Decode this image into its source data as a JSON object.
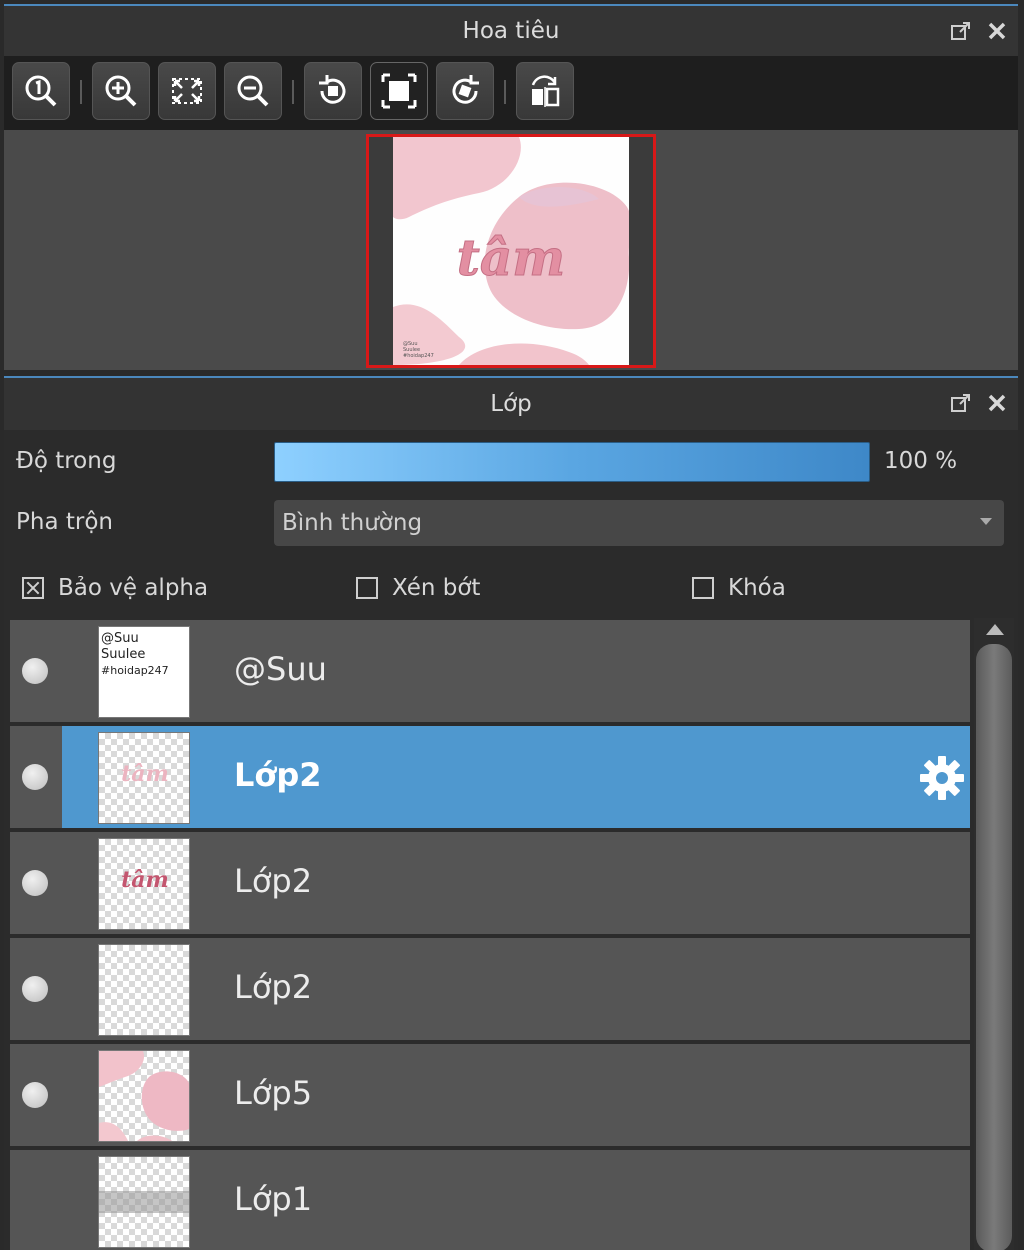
{
  "navigator": {
    "title": "Hoa tiêu",
    "toolbar": [
      "zoom-actual-size-icon",
      "zoom-in-icon",
      "fit-screen-icon",
      "zoom-out-icon",
      "rotate-left-icon",
      "fit-canvas-icon",
      "rotate-right-icon",
      "flip-horizontal-icon"
    ],
    "preview": {
      "artwork_text": "tâm",
      "watermark_lines": [
        "@Suu",
        "Suulee",
        "#hoidap247"
      ]
    }
  },
  "layers_panel": {
    "title": "Lớp",
    "opacity_label": "Độ trong",
    "opacity_value_text": "100 %",
    "opacity_value": 100,
    "blend_label": "Pha trộn",
    "blend_value": "Bình thường",
    "checkboxes": [
      {
        "label": "Bảo vệ alpha",
        "checked": true
      },
      {
        "label": "Xén bớt",
        "checked": false
      },
      {
        "label": "Khóa",
        "checked": false
      }
    ],
    "layers": [
      {
        "name": "@Suu",
        "thumb_text": [
          "@Suu",
          "Suulee",
          "#hoidap247"
        ],
        "visible": true,
        "selected": false
      },
      {
        "name": "Lớp2",
        "thumb_text": [
          "tâm"
        ],
        "visible": true,
        "selected": true
      },
      {
        "name": "Lớp2",
        "thumb_text": [
          "tâm"
        ],
        "visible": true,
        "selected": false
      },
      {
        "name": "Lớp2",
        "thumb_text": [],
        "visible": true,
        "selected": false
      },
      {
        "name": "Lớp5",
        "thumb_text": [],
        "visible": true,
        "selected": false
      },
      {
        "name": "Lớp1",
        "thumb_text": [],
        "visible": false,
        "selected": false
      }
    ]
  },
  "colors": {
    "accent": "#4f98cf",
    "selection_frame": "#d81818",
    "panel_bg": "#555555"
  }
}
